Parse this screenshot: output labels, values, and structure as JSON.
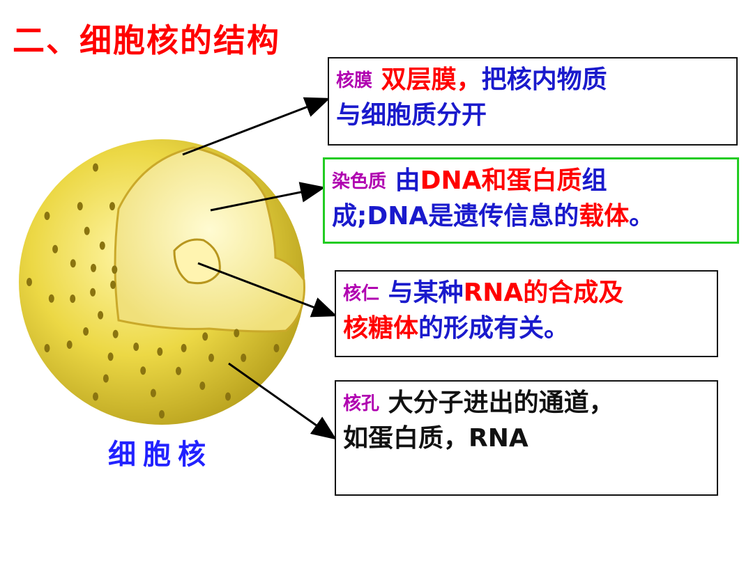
{
  "title": "二、细胞核的结构",
  "caption": "细胞核",
  "boxes": {
    "membrane": {
      "label": "核膜",
      "text_a": "双层膜，",
      "text_b": "把核内物质",
      "text_c": "与细胞质分开"
    },
    "chromatin": {
      "label": "染色质",
      "text_a": "由",
      "text_b": "DNA和蛋白质",
      "text_c": "组",
      "text_d": "成;DNA是遗传信息的",
      "text_e": "载体",
      "text_f": "。"
    },
    "nucleolus": {
      "label": "核仁",
      "text_a": "与某种",
      "text_b": "RNA的合成及",
      "text_c": "核糖体",
      "text_d": "的形成有关。"
    },
    "pore": {
      "label": "核孔",
      "text_a": "大分子进出的通道，",
      "text_b": "如蛋白质，RNA"
    }
  },
  "colors": {
    "title": "#ff0000",
    "label": "#b000b0",
    "accent_red": "#ff0000",
    "accent_blue": "#1a1acc",
    "green_border": "#22cc22",
    "nucleus_yellow": "#e6d23a"
  }
}
